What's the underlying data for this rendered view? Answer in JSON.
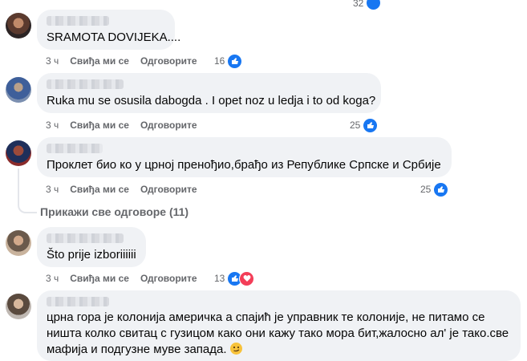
{
  "comments": [
    {
      "text": "SRAMOTA DOVIJEKA....",
      "time": "3 ч",
      "like_label": "Свиђа ми се",
      "reply_label": "Одговорите",
      "reaction_count": "16",
      "reactions": [
        "like-icon"
      ]
    },
    {
      "text": "Ruka mu se osusila dabogda . I opet noz u ledja i to od koga?",
      "time": "3 ч",
      "like_label": "Свиђа ми се",
      "reply_label": "Одговорите",
      "reaction_count": "25",
      "reactions": [
        "like-icon"
      ]
    },
    {
      "text": "Проклет био ко у црној пренођио,брађо из Републике Српске и Србије",
      "time": "3 ч",
      "like_label": "Свиђа ми се",
      "reply_label": "Одговорите",
      "reaction_count": "25",
      "reactions": [
        "like-icon"
      ]
    },
    {
      "text": "Što prije izboriiiiii",
      "time": "3 ч",
      "like_label": "Свиђа ми се",
      "reply_label": "Одговорите",
      "reaction_count": "13",
      "reactions": [
        "like-icon",
        "love-icon"
      ]
    },
    {
      "text": "црна гора је колонија америчка а спајић је управник те колоније, не питамо се ништа колко свитац с гузицом како они кажу тако мора бит,жалосно ал' је тако.све мафија и подгузне муве запада.",
      "emoji": "smirk-emoji"
    }
  ],
  "show_replies_label": "Прикажи све одговоре (11)",
  "top_partial_count": "32",
  "colors": {
    "bubble": "#f0f2f5",
    "meta_text": "#65676b",
    "like_blue": "#1877f2",
    "love_red": "#f33e58"
  }
}
